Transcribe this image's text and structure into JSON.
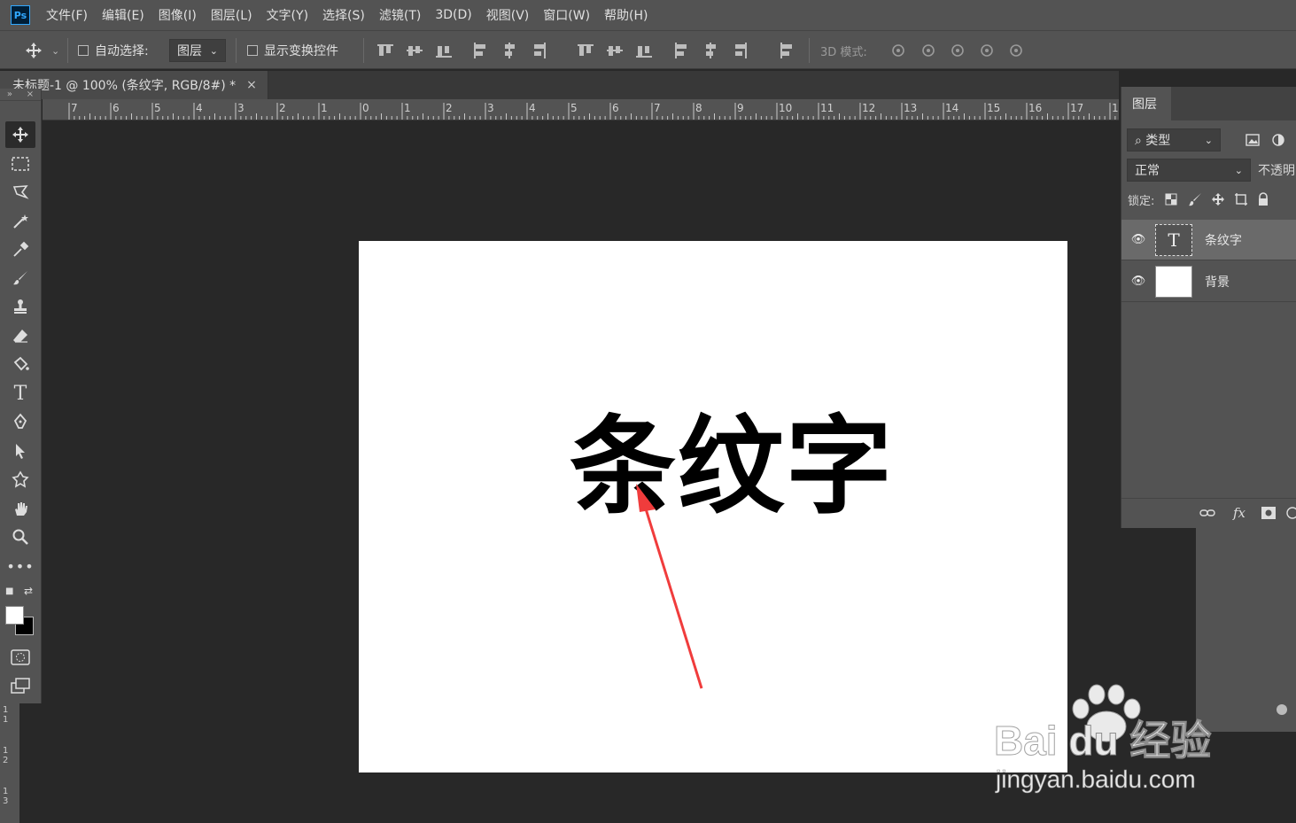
{
  "app": {
    "logo": "Ps"
  },
  "menu": [
    "文件(F)",
    "编辑(E)",
    "图像(I)",
    "图层(L)",
    "文字(Y)",
    "选择(S)",
    "滤镜(T)",
    "3D(D)",
    "视图(V)",
    "窗口(W)",
    "帮助(H)"
  ],
  "options": {
    "auto_select_label": "自动选择:",
    "auto_select_value": "图层",
    "show_transform_label": "显示变换控件",
    "mode_3d_label": "3D 模式:"
  },
  "document": {
    "tab_title": "未标题-1 @ 100% (条纹字, RGB/8#) *",
    "close_glyph": "×",
    "canvas_text": "条纹字"
  },
  "ruler": {
    "top_labels": [
      "7",
      "6",
      "5",
      "4",
      "3",
      "2",
      "1",
      "0",
      "1",
      "2",
      "3",
      "4",
      "5",
      "6",
      "7",
      "8",
      "9",
      "10",
      "11",
      "12",
      "13",
      "14",
      "15",
      "16",
      "17",
      "1"
    ],
    "left_labels": [
      "1\n1",
      "1\n2",
      "1\n3"
    ]
  },
  "layers_panel": {
    "tab_label": "图层",
    "filter_label": "类型",
    "blend_mode": "正常",
    "opacity_label": "不透明",
    "lock_label": "锁定:",
    "layers": [
      {
        "name": "条纹字",
        "type": "text",
        "selected": true,
        "thumb_glyph": "T"
      },
      {
        "name": "背景",
        "type": "background",
        "selected": false
      }
    ],
    "footer": {
      "fx_label": "fx"
    }
  },
  "watermark": {
    "brand": "Bai du 经验",
    "url": "jingyan.baidu.com"
  },
  "colors": {
    "ui_bg": "#535353",
    "workspace": "#282828",
    "arrow": "#f03c3c",
    "ps_accent": "#31a8ff"
  }
}
